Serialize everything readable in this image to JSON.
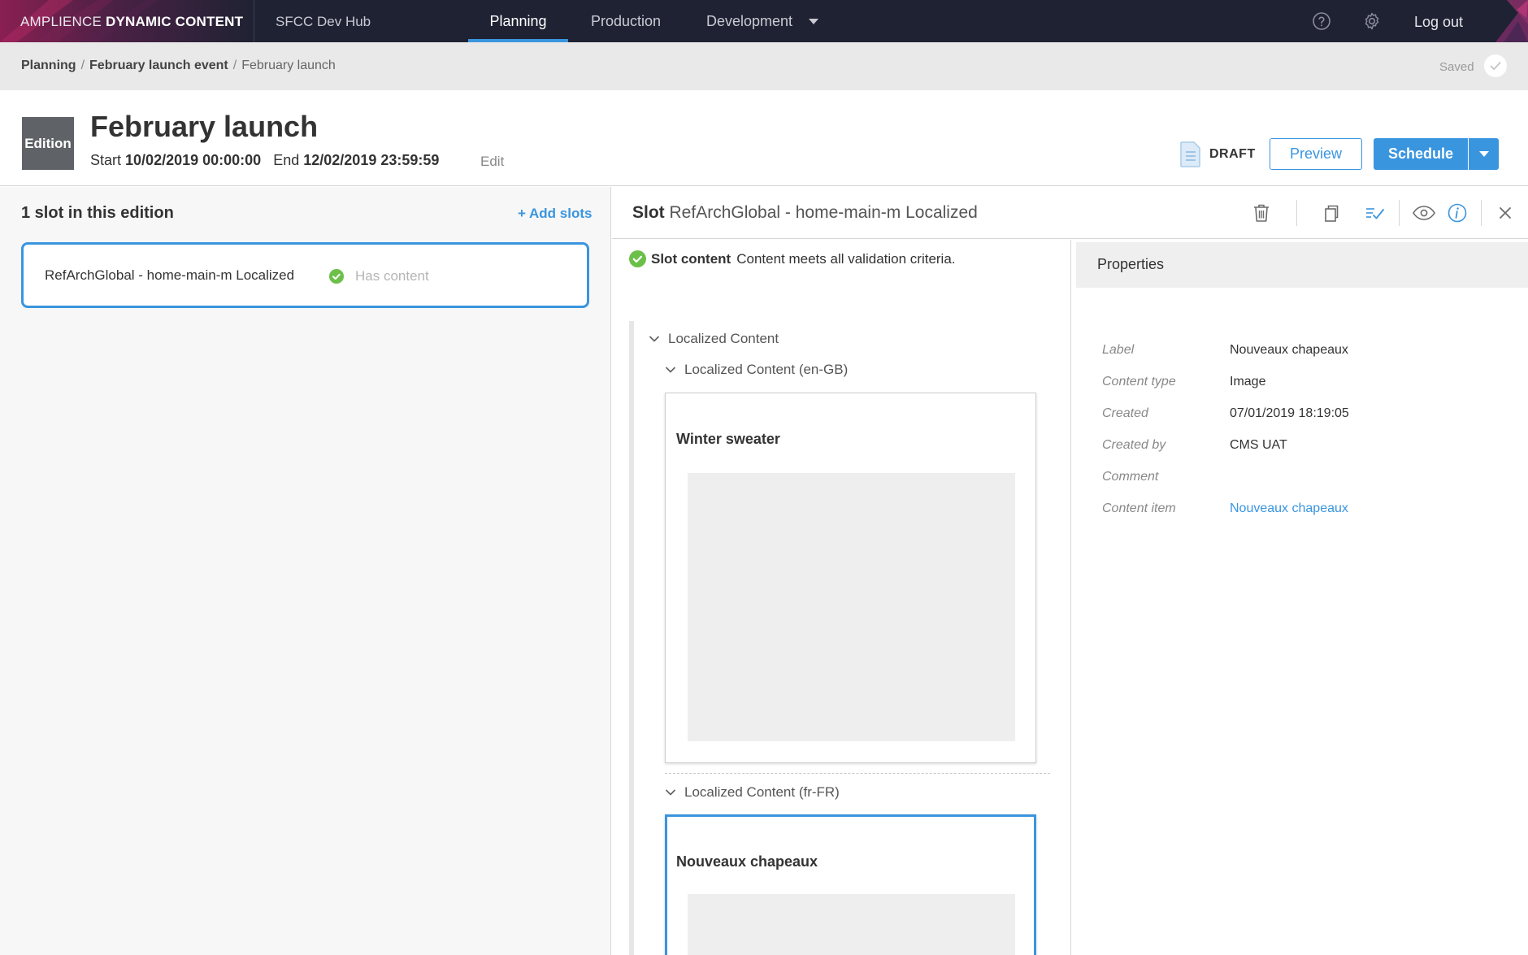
{
  "topnav": {
    "brand_light": "AMPLIENCE ",
    "brand_bold": "DYNAMIC CONTENT",
    "hub": "SFCC Dev Hub",
    "tabs": [
      {
        "label": "Planning",
        "active": true
      },
      {
        "label": "Production",
        "active": false
      },
      {
        "label": "Development",
        "active": false
      }
    ],
    "icons": [
      "help-icon",
      "gear-icon"
    ],
    "logout": "Log out"
  },
  "breadcrumb": {
    "items": [
      "Planning",
      "February launch event"
    ],
    "current": "February launch",
    "separator": "/",
    "status": "Saved"
  },
  "edition": {
    "badge": "Edition",
    "title": "February launch",
    "start_label": "Start",
    "start": "10/02/2019 00:00:00",
    "end_label": "End",
    "end": "12/02/2019 23:59:59",
    "edit": "Edit",
    "status": "DRAFT",
    "preview": "Preview",
    "schedule": "Schedule"
  },
  "slots_panel": {
    "heading": "1 slot in this edition",
    "add": "+ Add slots",
    "slots": [
      {
        "name": "RefArchGlobal - home-main-m Localized",
        "status": "Has content"
      }
    ]
  },
  "slot_detail": {
    "prefix": "Slot",
    "name": "RefArchGlobal - home-main-m Localized",
    "toolbar_icons": [
      "trash-icon",
      "copy-icon",
      "validate-icon",
      "eye-icon",
      "info-icon",
      "close-icon"
    ],
    "validation_title": "Slot content",
    "validation_text": "Content meets all validation criteria.",
    "tree": {
      "root": "Localized Content",
      "locales": [
        {
          "label": "Localized Content (en-GB)",
          "card_title": "Winter sweater"
        },
        {
          "label": "Localized Content (fr-FR)",
          "card_title": "Nouveaux chapeaux"
        }
      ]
    }
  },
  "properties": {
    "title": "Properties",
    "rows": [
      {
        "label": "Label",
        "value": "Nouveaux chapeaux"
      },
      {
        "label": "Content type",
        "value": "Image"
      },
      {
        "label": "Created",
        "value": "07/01/2019 18:19:05"
      },
      {
        "label": "Created by",
        "value": "CMS UAT"
      },
      {
        "label": "Comment",
        "value": ""
      },
      {
        "label": "Content item",
        "value": "Nouveaux chapeaux",
        "link": true
      }
    ]
  },
  "colors": {
    "nav_bg": "#1f2233",
    "accent": "#3a95df",
    "success": "#6cc04a"
  }
}
